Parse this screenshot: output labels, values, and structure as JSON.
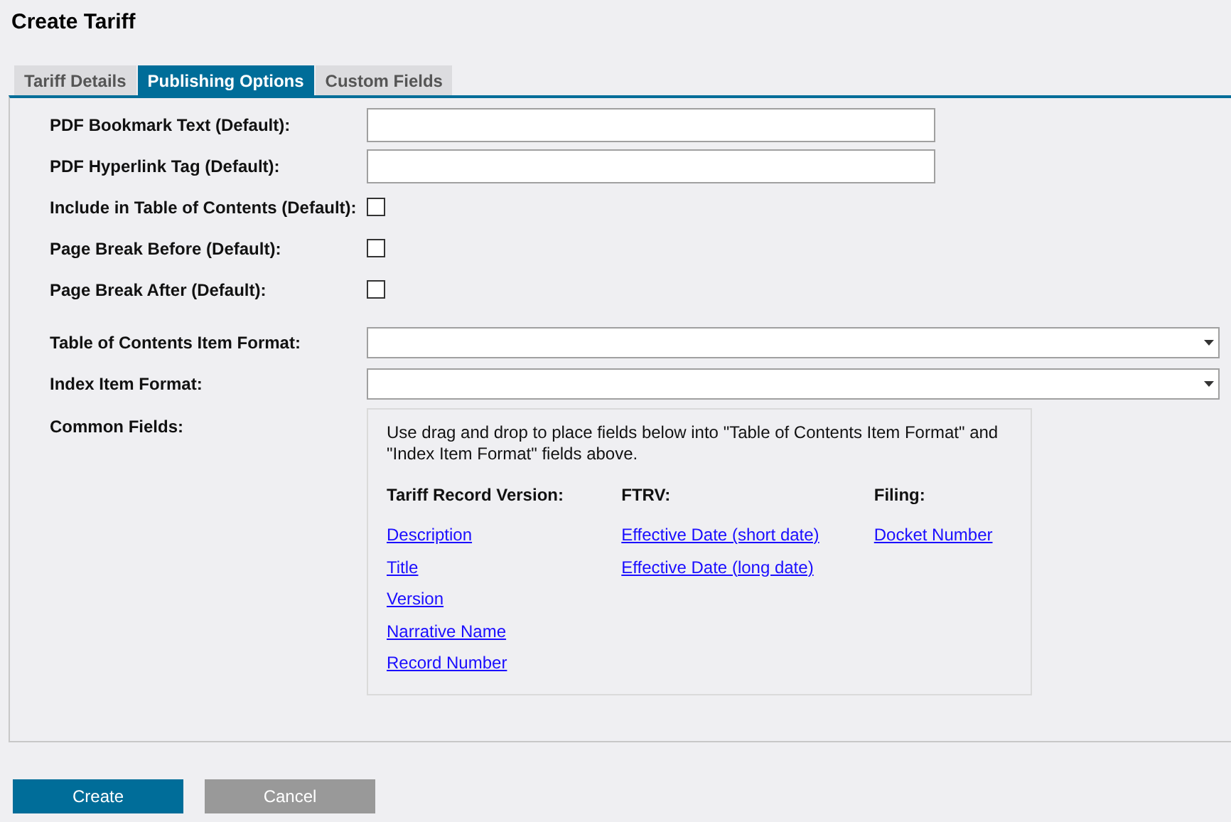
{
  "title": "Create Tariff",
  "tabs": [
    {
      "label": "Tariff Details",
      "selected": false
    },
    {
      "label": "Publishing Options",
      "selected": true
    },
    {
      "label": "Custom Fields",
      "selected": false
    }
  ],
  "fields": [
    {
      "label": "PDF Bookmark Text (Default):",
      "kind": "text"
    },
    {
      "label": "PDF Hyperlink Tag (Default):",
      "kind": "text"
    },
    {
      "label": "Include in Table of Contents (Default):",
      "kind": "checkbox",
      "checked": false
    },
    {
      "label": "Page Break Before (Default):",
      "kind": "checkbox",
      "checked": false
    },
    {
      "label": "Page Break After (Default):",
      "kind": "checkbox",
      "checked": false
    },
    {
      "label": "Table of Contents Item Format:",
      "kind": "select"
    },
    {
      "label": "Index Item Format:",
      "kind": "select"
    }
  ],
  "common_fields": {
    "label": "Common Fields:",
    "hint": "Use drag and drop to place fields below into \"Table of Contents Item Format\" and \"Index Item Format\" fields above.",
    "groups": [
      {
        "heading": "Tariff Record Version:",
        "links": [
          "Description",
          "Title",
          "Version",
          "Narrative Name",
          "Record Number"
        ]
      },
      {
        "heading": "FTRV:",
        "links": [
          "Effective Date (short date)",
          "Effective Date (long date)"
        ]
      },
      {
        "heading": "Filing:",
        "links": [
          "Docket Number"
        ]
      }
    ]
  },
  "buttons": [
    {
      "label": "Create",
      "kind": "primary"
    },
    {
      "label": "Cancel",
      "kind": "secondary"
    }
  ]
}
